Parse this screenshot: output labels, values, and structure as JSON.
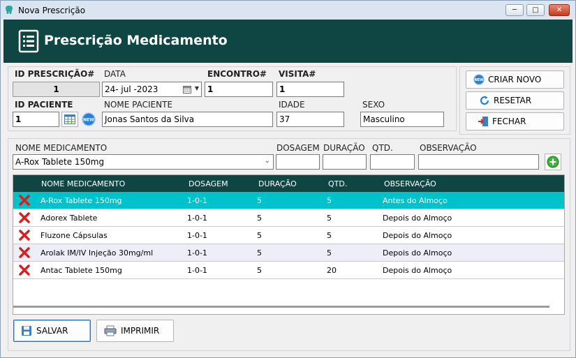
{
  "window": {
    "title": "Nova Prescrição",
    "min": "─",
    "max": "□",
    "close": "✕"
  },
  "header": {
    "title": "Prescrição Medicamento"
  },
  "form": {
    "prescription_id_label": "ID PRESCRIÇÃO#",
    "prescription_id": "1",
    "date_label": "DATA",
    "date": "24- jul -2023",
    "encounter_label": "ENCONTRO#",
    "encounter": "1",
    "visit_label": "VISITA#",
    "visit": "1",
    "patient_id_label": "ID PACIENTE",
    "patient_id": "1",
    "patient_name_label": "NOME PACIENTE",
    "patient_name": "Jonas Santos da Silva",
    "age_label": "IDADE",
    "age": "37",
    "sex_label": "SEXO",
    "sex": "Masculino"
  },
  "side_buttons": {
    "new": "CRIAR NOVO",
    "reset": "RESETAR",
    "close": "FECHAR"
  },
  "medicine": {
    "name_label": "NOME MEDICAMENTO",
    "name": "A-Rox Tablete 150mg",
    "dosage_label": "DOSAGEM",
    "duration_label": "DURAÇÃO",
    "qty_label": "QTD.",
    "note_label": "OBSERVAÇÃO"
  },
  "grid": {
    "columns": [
      "NOME MEDICAMENTO",
      "DOSAGEM",
      "DURAÇÃO",
      "QTD.",
      "OBSERVAÇÃO"
    ],
    "rows": [
      {
        "name": "A-Rox Tablete 150mg",
        "dosage": "1-0-1",
        "duration": "5",
        "qty": "5",
        "note": "Antes do Almoço"
      },
      {
        "name": "Adorex Tablete",
        "dosage": "1-0-1",
        "duration": "5",
        "qty": "5",
        "note": "Depois do Almoço"
      },
      {
        "name": "Fluzone Cápsulas",
        "dosage": "1-0-1",
        "duration": "5",
        "qty": "5",
        "note": "Depois do Almoço"
      },
      {
        "name": "Arolak IM/IV Injeção 30mg/ml",
        "dosage": "1-0-1",
        "duration": "5",
        "qty": "5",
        "note": "Depois do Almoço"
      },
      {
        "name": "Antac Tablete 150mg",
        "dosage": "1-0-1",
        "duration": "5",
        "qty": "20",
        "note": "Depois do Almoço"
      }
    ]
  },
  "bottom_buttons": {
    "save": "SALVAR",
    "print": "IMPRIMIR"
  },
  "colors": {
    "header": "#0f4543",
    "selected_row": "#00c2cb"
  }
}
